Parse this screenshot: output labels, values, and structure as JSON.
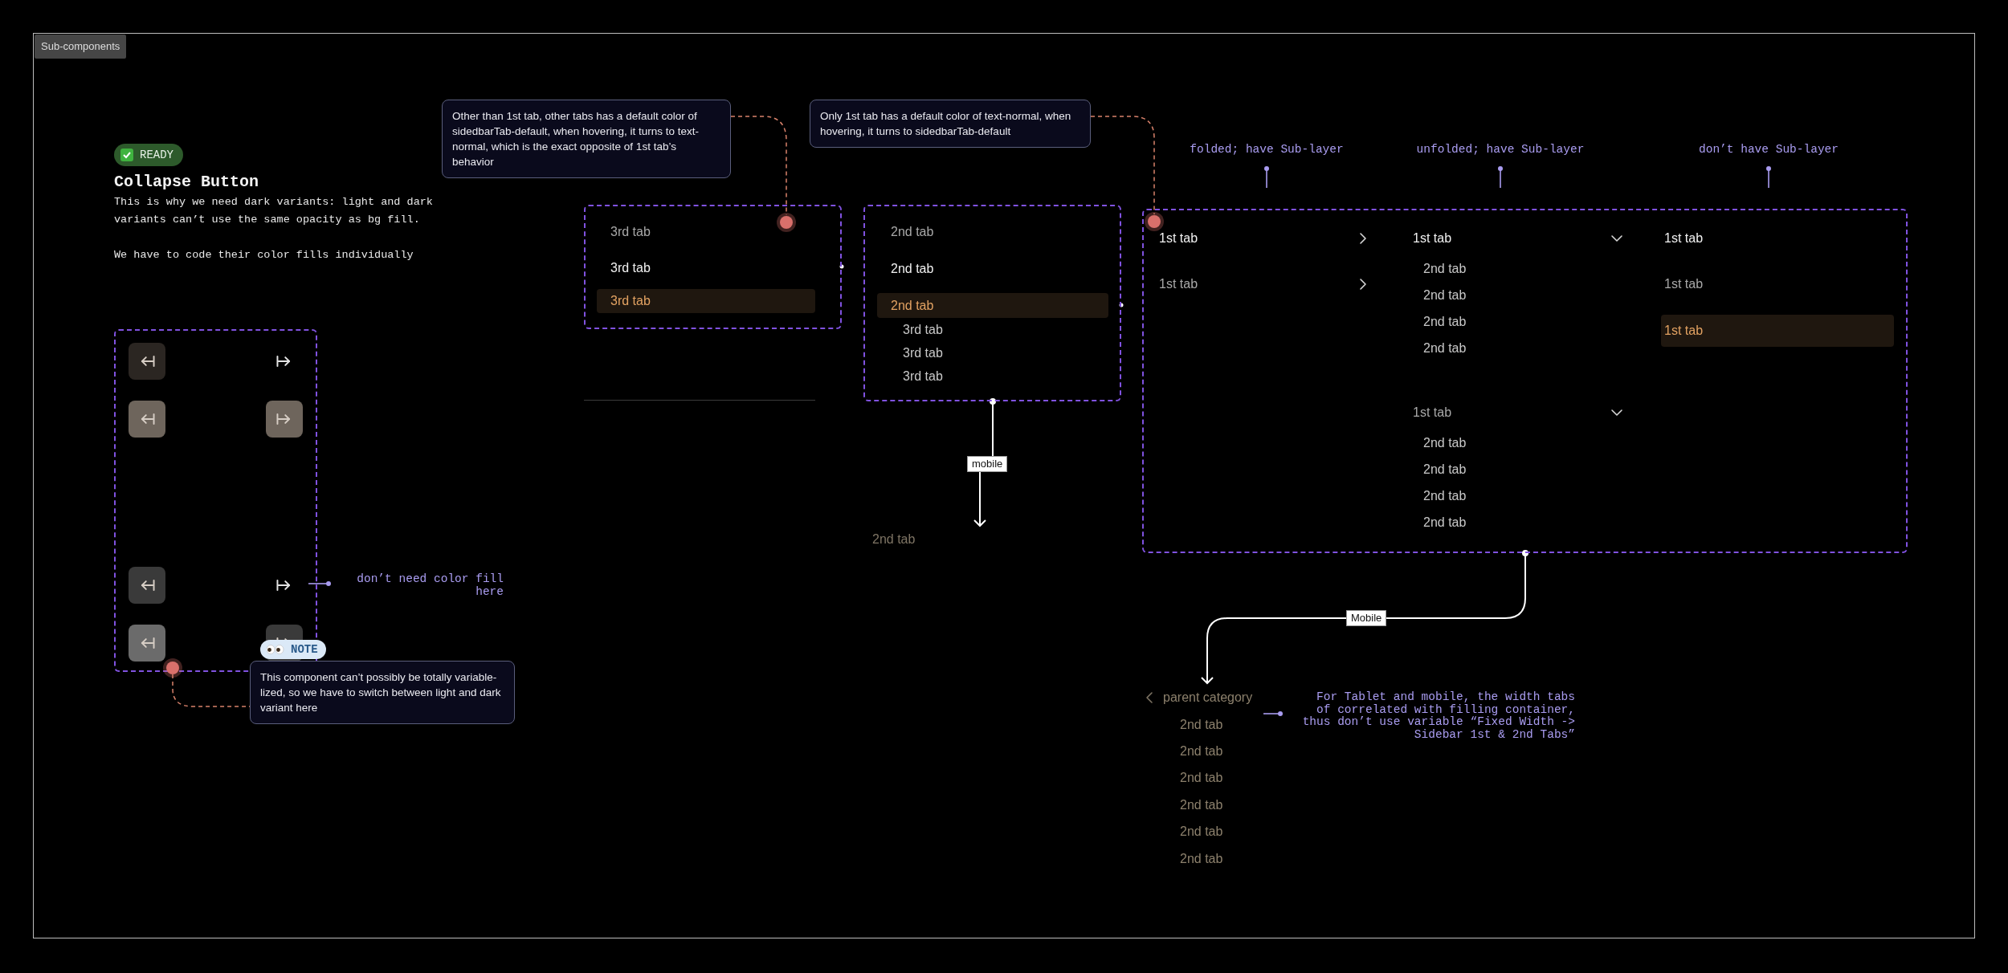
{
  "frame_label": "Sub-components",
  "collapse_section": {
    "badge": "READY",
    "title": "Collapse Button",
    "paragraphs": [
      "This is why we need dark variants: light and dark variants can’t use the same opacity as bg fill.",
      "We have to code their color fills individually"
    ],
    "buttons": [
      {
        "kind": "collapse",
        "color": "#2b2622"
      },
      {
        "kind": "expand"
      },
      {
        "kind": "collapse",
        "color": "#6e655c"
      },
      {
        "kind": "expand",
        "color": "#6e655c"
      },
      {
        "kind": "collapse",
        "color": "#3a3a3a"
      },
      {
        "kind": "expand"
      },
      {
        "kind": "collapse",
        "color": "#6b6b6b"
      },
      {
        "kind": "expand",
        "color": "#3a3a3a"
      }
    ],
    "annotation": "don’t need color fill here",
    "note": {
      "badge": "NOTE",
      "text": "This component can’t possibly be totally variable-lized, so we have to switch between light and dark variant here"
    }
  },
  "notes": [
    {
      "text": "Other than 1st tab, other tabs has a default color of sidedbarTab-default, when hovering, it turns to text-normal, which is the exact opposite of 1st tab’s behavior"
    },
    {
      "text": "Only 1st tab has a default color of text-normal, when hovering, it turns to sidedbarTab-default"
    }
  ],
  "third_tab_states": {
    "tabs": [
      {
        "label": "3rd tab",
        "hovered": false,
        "selected": false
      },
      {
        "label": "3rd tab",
        "hovered": true,
        "selected": false
      },
      {
        "label": "3rd tab",
        "selected": true
      }
    ]
  },
  "second_tab_states": {
    "tabs": [
      {
        "label": "2nd tab",
        "hovered": false,
        "selected": false
      },
      {
        "label": "2nd tab",
        "hovered": true,
        "selected": false
      },
      {
        "label": "2nd tab",
        "selected": true,
        "children": [
          {
            "label": "3rd tab"
          },
          {
            "label": "3rd tab"
          },
          {
            "label": "3rd tab"
          }
        ]
      }
    ],
    "connector_label": "mobile",
    "mobile_tab": "2nd tab"
  },
  "first_tab_states": {
    "columns": [
      {
        "caption": "folded; have Sub-layer",
        "tabs": [
          {
            "label": "1st tab",
            "hovered": false,
            "expanded": false
          },
          {
            "label": "1st tab",
            "hovered": true,
            "expanded": false
          }
        ]
      },
      {
        "caption": "unfolded; have Sub-layer",
        "tabs": [
          {
            "label": "1st tab",
            "hovered": false,
            "expanded": true,
            "children": [
              {
                "label": "2nd tab"
              },
              {
                "label": "2nd tab"
              },
              {
                "label": "2nd tab"
              },
              {
                "label": "2nd tab"
              }
            ]
          },
          {
            "label": "1st tab",
            "hovered": true,
            "expanded": true,
            "children": [
              {
                "label": "2nd tab"
              },
              {
                "label": "2nd tab"
              },
              {
                "label": "2nd tab"
              },
              {
                "label": "2nd tab"
              }
            ]
          }
        ]
      },
      {
        "caption": "don’t have Sub-layer",
        "tabs": [
          {
            "label": "1st tab",
            "hovered": false,
            "selected": false
          },
          {
            "label": "1st tab",
            "hovered": true,
            "selected": false
          },
          {
            "label": "1st tab",
            "selected": true
          }
        ]
      }
    ],
    "connector_label": "Mobile"
  },
  "mobile_menu": {
    "back_label": "parent category",
    "tabs": [
      "2nd tab",
      "2nd tab",
      "2nd tab",
      "2nd tab",
      "2nd tab",
      "2nd tab"
    ],
    "annotation": "For Tablet and mobile, the width tabs of correlated with filling container, thus don’t use variable “Fixed Width -> Sidebar 1st & 2nd Tabs”"
  }
}
